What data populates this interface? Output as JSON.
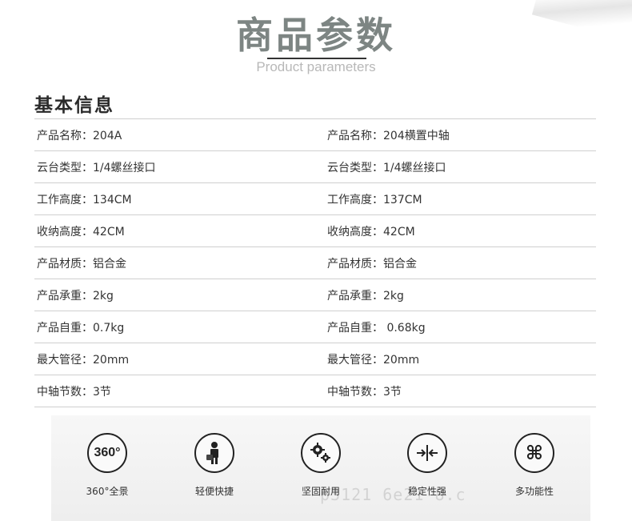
{
  "header": {
    "title_cn": "商品参数",
    "title_en": "Product parameters"
  },
  "section": {
    "title": "基本信息"
  },
  "rows": [
    {
      "left": "产品名称：204A",
      "right": "产品名称：204横置中轴"
    },
    {
      "left": "云台类型：1/4螺丝接口",
      "right": "云台类型：1/4螺丝接口"
    },
    {
      "left": "工作高度：134CM",
      "right": "工作高度：137CM"
    },
    {
      "left": "收纳高度：42CM",
      "right": "收纳高度：42CM"
    },
    {
      "left": "产品材质：铝合金",
      "right": "产品材质：铝合金"
    },
    {
      "left": "产品承重：2kg",
      "right": "产品承重：2kg"
    },
    {
      "left": "产品自重：0.7kg",
      "right": "产品自重：  0.68kg"
    },
    {
      "left": "最大管径：20mm",
      "right": "最大管径：20mm"
    },
    {
      "left": "中轴节数：3节",
      "right": "中轴节数：3节"
    }
  ],
  "features": [
    {
      "icon": "360-icon",
      "icon_text": "360°",
      "label": "360°全景"
    },
    {
      "icon": "person-briefcase-icon",
      "label": "轻便快捷"
    },
    {
      "icon": "gears-icon",
      "label": "坚固耐用"
    },
    {
      "icon": "compress-arrows-icon",
      "label": "稳定性强"
    },
    {
      "icon": "command-icon",
      "label": "多功能性"
    }
  ],
  "watermark": "p3121 6e21 8.c"
}
